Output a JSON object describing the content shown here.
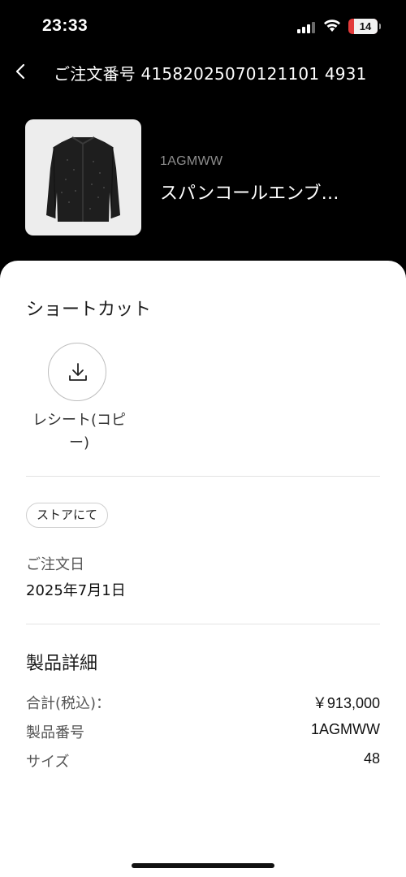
{
  "status_bar": {
    "time": "23:33",
    "battery": "14"
  },
  "header": {
    "title": "ご注文番号 41582025070121101 4931"
  },
  "product": {
    "code": "1AGMWW",
    "name": "スパンコールエンブ…",
    "image_icon": "jacket-icon"
  },
  "shortcuts": {
    "title": "ショートカット",
    "items": [
      {
        "label": "レシート(コピー)",
        "icon": "download-icon"
      }
    ]
  },
  "order": {
    "store_badge": "ストアにて",
    "date_label": "ご注文日",
    "date_value": "2025年7月1日"
  },
  "details": {
    "title": "製品詳細",
    "rows": [
      {
        "label": "合計(税込)：",
        "value": "￥913,000"
      },
      {
        "label": "製品番号",
        "value": "1AGMWW"
      },
      {
        "label": "サイズ",
        "value": "48"
      }
    ]
  },
  "colors": {
    "background": "#000000",
    "sheet": "#ffffff",
    "battery_low": "#e33b3b"
  }
}
